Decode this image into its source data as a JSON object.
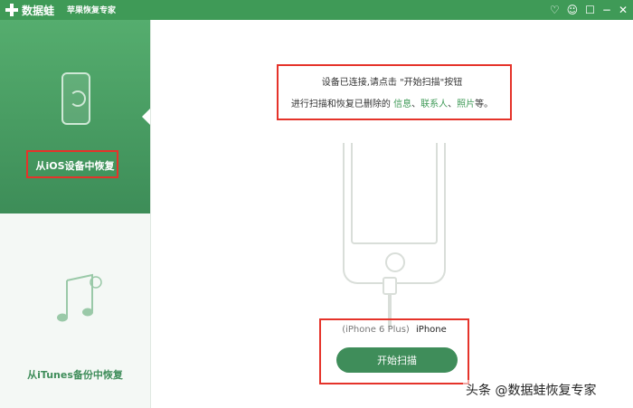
{
  "window": {
    "app_name": "数据蛙",
    "subtitle": "苹果恢复专家"
  },
  "controls": {
    "icons": [
      "heart-icon",
      "user-icon",
      "message-icon",
      "minimize-icon",
      "close-icon"
    ]
  },
  "sidebar": {
    "ios_label": "从iOS设备中恢复",
    "itunes_label": "从iTunes备份中恢复"
  },
  "main": {
    "notice_line1": "设备已连接,请点击 \"开始扫描\"按钮",
    "notice_line2_prefix": "进行扫描和恢复已删除的",
    "notice_items": [
      "信息",
      "联系人",
      "照片"
    ],
    "notice_suffix": "等。",
    "device_model": "(iPhone 6 Plus)",
    "device_name": "iPhone",
    "scan_button": "开始扫描"
  },
  "watermark": "头条 @数据蛙恢复专家",
  "colors": {
    "title_green": "#3f9a57",
    "highlight_red": "#e5332a",
    "sidebar_green": "#4e9f69"
  }
}
